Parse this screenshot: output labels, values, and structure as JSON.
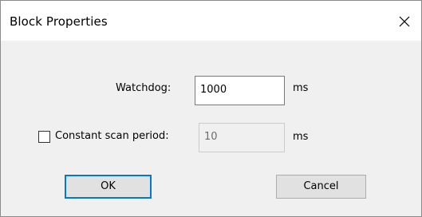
{
  "dialog": {
    "title": "Block Properties",
    "close_icon": "close-icon"
  },
  "watchdog": {
    "label": "Watchdog:",
    "value": "1000",
    "unit": "ms"
  },
  "scan_period": {
    "label": "Constant scan period:",
    "checked": false,
    "value": "10",
    "unit": "ms",
    "enabled": false
  },
  "buttons": {
    "ok": "OK",
    "cancel": "Cancel"
  },
  "colors": {
    "default_button_border": "#0078d7",
    "dialog_background": "#f0f0f0",
    "titlebar_background": "#ffffff"
  }
}
